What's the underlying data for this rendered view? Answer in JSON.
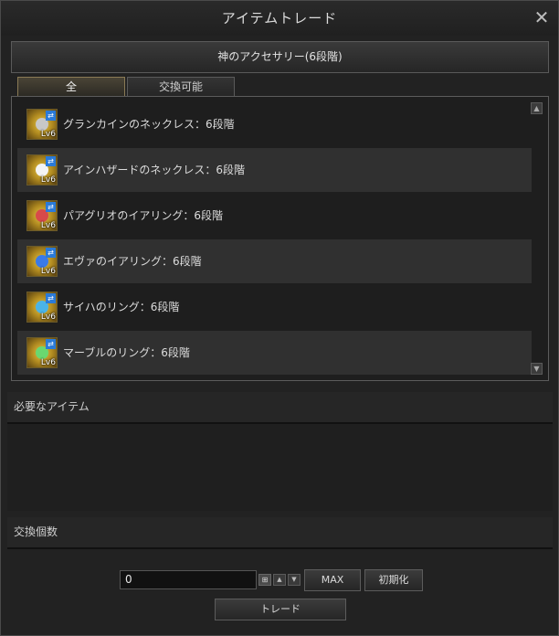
{
  "window": {
    "title": "アイテムトレード"
  },
  "category": {
    "label": "神のアクセサリー(6段階)"
  },
  "tabs": [
    {
      "label": "全"
    },
    {
      "label": "交換可能"
    }
  ],
  "items": [
    {
      "label": "グランカインのネックレス：6段階",
      "level": "Lv6",
      "gem_color": "#c8c8c8"
    },
    {
      "label": "アインハザードのネックレス：6段階",
      "level": "Lv6",
      "gem_color": "#f4f4f4"
    },
    {
      "label": "パアグリオのイアリング：6段階",
      "level": "Lv6",
      "gem_color": "#d84a4a"
    },
    {
      "label": "エヴァのイアリング：6段階",
      "level": "Lv6",
      "gem_color": "#3a7ae8"
    },
    {
      "label": "サイハのリング：6段階",
      "level": "Lv6",
      "gem_color": "#4ab4e8"
    },
    {
      "label": "マーブルのリング：6段階",
      "level": "Lv6",
      "gem_color": "#6ad870"
    }
  ],
  "sections": {
    "required": "必要なアイテム",
    "quantity": "交換個数"
  },
  "controls": {
    "quantity_value": "0",
    "max_label": "MAX",
    "reset_label": "初期化",
    "trade_label": "トレード"
  }
}
